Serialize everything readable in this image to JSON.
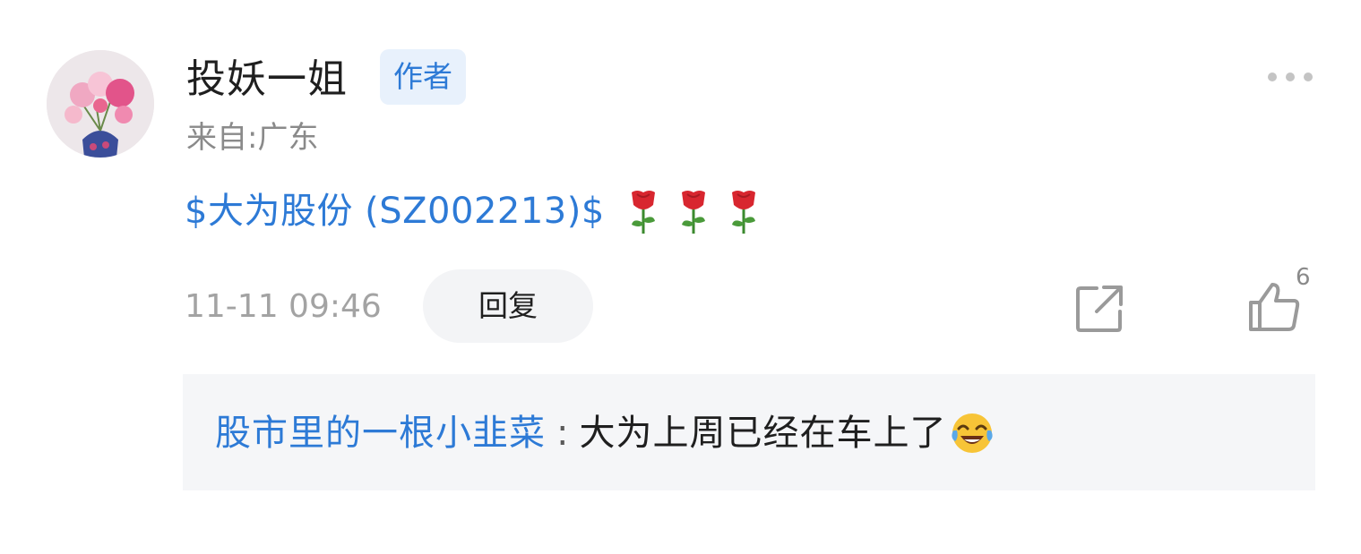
{
  "post": {
    "author": {
      "name": "投妖一姐",
      "badge": "作者",
      "location": "来自:广东"
    },
    "content": {
      "stock_link": "$大为股份 (SZ002213)$",
      "emojis": [
        "rose-emoji",
        "rose-emoji",
        "rose-emoji"
      ]
    },
    "meta": {
      "timestamp": "11-11 09:46",
      "reply_label": "回复",
      "like_count": "6"
    }
  },
  "reply": {
    "user": "股市里的一根小韭菜",
    "separator": ":",
    "text": "大为上周已经在车上了",
    "emoji": "tears-of-joy-emoji"
  },
  "colors": {
    "link": "#2d7ad6",
    "badge_bg": "#e8f1fc",
    "muted": "#8a8a8a",
    "reply_bg": "#f5f6f8"
  }
}
